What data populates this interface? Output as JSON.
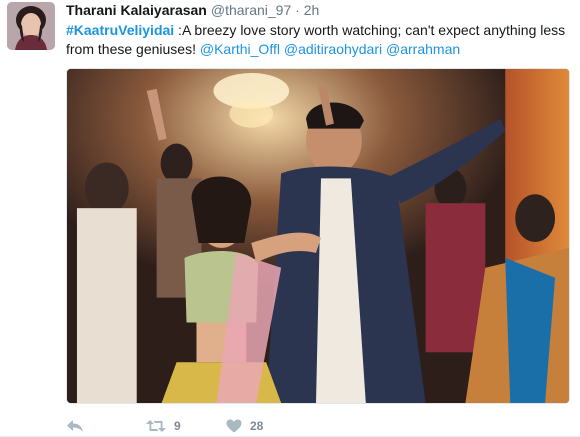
{
  "tweet": {
    "display_name": "Tharani Kalaiyarasan",
    "handle": "@tharani_97",
    "separator": "·",
    "time": "2h",
    "text_parts": {
      "hashtag": "#KaatruVeliyidai",
      "body": " :A breezy love story worth watching; can't expect anything less from these geniuses! ",
      "mention1": "@Karthi_Offl",
      "mention2": "@aditiraohydari",
      "mention3": "@arrahman"
    },
    "retweet_count": "9",
    "like_count": "28"
  },
  "icons": {
    "avatar": "profile-photo",
    "reply": "reply-icon",
    "retweet": "retweet-icon",
    "like": "heart-icon"
  },
  "colors": {
    "link": "#1b95e0",
    "text": "#14171a",
    "muted": "#657786",
    "icon": "#aab8c2"
  }
}
